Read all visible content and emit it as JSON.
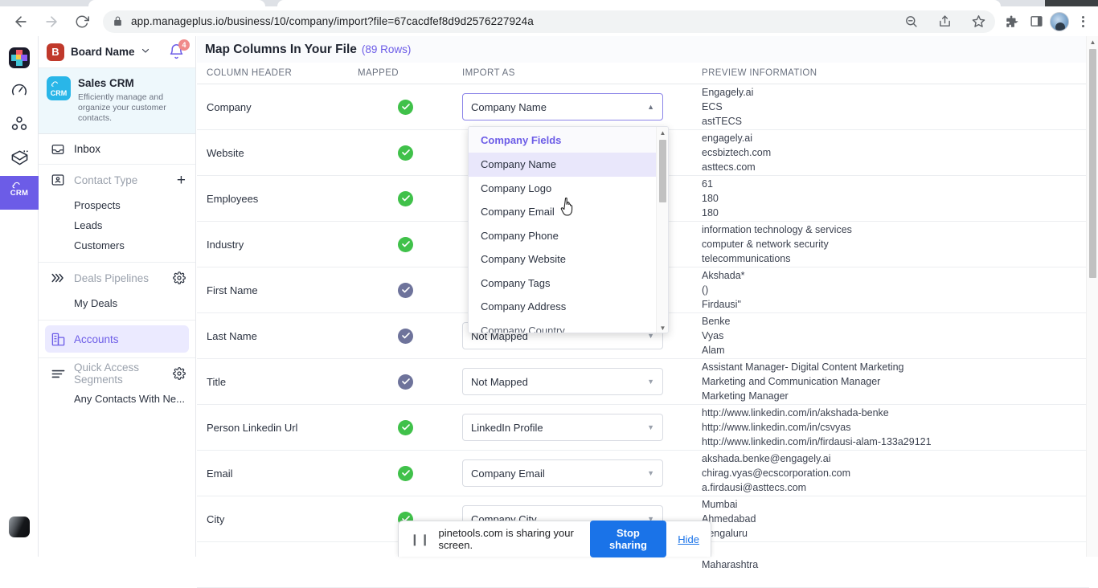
{
  "browser": {
    "url": "app.manageplus.io/business/10/company/import?file=67cacdfef8d9d2576227924a",
    "back_icon": "back-arrow-icon",
    "forward_icon": "forward-arrow-icon",
    "reload_icon": "reload-icon",
    "lock_icon": "lock-icon",
    "zoom_icon": "zoom-out-icon",
    "share_icon": "share-icon",
    "bookmark_icon": "star-icon",
    "extensions_icon": "puzzle-icon",
    "side_panel_icon": "side-panel-icon",
    "profile_icon": "profile-avatar",
    "menu_icon": "three-dot-menu-icon"
  },
  "rail": {
    "items": [
      {
        "name": "app-logo",
        "label": ""
      },
      {
        "name": "dashboard-icon",
        "label": ""
      },
      {
        "name": "teams-icon",
        "label": ""
      },
      {
        "name": "campaigns-icon",
        "label": ""
      },
      {
        "name": "crm-icon",
        "label": "CRM"
      }
    ],
    "bottom_avatar": "user-avatar"
  },
  "sidebar": {
    "board": {
      "badge": "B",
      "name": "Board Name",
      "notifications": "4"
    },
    "product": {
      "badge": "CRM",
      "title": "Sales CRM",
      "description": "Efficiently manage and organize your customer contacts."
    },
    "inbox": "Inbox",
    "contact_type": {
      "label": "Contact Type",
      "items": [
        "Prospects",
        "Leads",
        "Customers"
      ]
    },
    "deals_pipelines": {
      "label": "Deals Pipelines",
      "items": [
        "My Deals"
      ]
    },
    "accounts": "Accounts",
    "quick_access": {
      "label": "Quick Access Segments",
      "items": [
        "Any Contacts With Ne..."
      ]
    }
  },
  "main": {
    "title": "Map Columns In Your File",
    "row_count": "(89 Rows)",
    "columns": [
      "COLUMN HEADER",
      "MAPPED",
      "IMPORT AS",
      "PREVIEW INFORMATION"
    ],
    "rows": [
      {
        "header": "Company",
        "mapped": "green",
        "import_as": "Company Name",
        "open": true,
        "preview": [
          "Engagely.ai",
          "ECS",
          "astTECS"
        ]
      },
      {
        "header": "Website",
        "mapped": "green",
        "import_as": "",
        "preview": [
          "engagely.ai",
          "ecsbiztech.com",
          "asttecs.com"
        ]
      },
      {
        "header": "Employees",
        "mapped": "green",
        "import_as": "",
        "preview": [
          "61",
          "180",
          "180"
        ]
      },
      {
        "header": "Industry",
        "mapped": "green",
        "import_as": "",
        "preview": [
          "information technology & services",
          "computer & network security",
          "telecommunications"
        ]
      },
      {
        "header": "First Name",
        "mapped": "purple",
        "import_as": "",
        "preview": [
          "Akshada*",
          "()",
          "Firdausi\""
        ]
      },
      {
        "header": "Last Name",
        "mapped": "purple",
        "import_as": "Not Mapped",
        "preview": [
          "Benke",
          "Vyas",
          "Alam"
        ]
      },
      {
        "header": "Title",
        "mapped": "purple",
        "import_as": "Not Mapped",
        "preview": [
          "Assistant Manager- Digital Content Marketing",
          "Marketing and Communication Manager",
          "Marketing Manager"
        ]
      },
      {
        "header": "Person Linkedin Url",
        "mapped": "green",
        "import_as": "LinkedIn Profile",
        "preview": [
          "http://www.linkedin.com/in/akshada-benke",
          "http://www.linkedin.com/in/csvyas",
          "http://www.linkedin.com/in/firdausi-alam-133a29121"
        ]
      },
      {
        "header": "Email",
        "mapped": "green",
        "import_as": "Company Email",
        "preview": [
          "akshada.benke@engagely.ai",
          "chirag.vyas@ecscorporation.com",
          "a.firdausi@asttecs.com"
        ]
      },
      {
        "header": "City",
        "mapped": "green",
        "import_as": "Company City",
        "preview": [
          "Mumbai",
          "Ahmedabad",
          "Bengaluru"
        ]
      },
      {
        "header": "",
        "mapped": "",
        "import_as": "",
        "preview": [
          "Maharashtra"
        ]
      }
    ]
  },
  "dropdown": {
    "group_label": "Company Fields",
    "items": [
      "Company Name",
      "Company Logo",
      "Company Email",
      "Company Phone",
      "Company Website",
      "Company Tags",
      "Company Address",
      "Company Country"
    ],
    "selected": "Company Name"
  },
  "share_bar": {
    "message": "pinetools.com is sharing your screen.",
    "stop_label": "Stop sharing",
    "hide_label": "Hide"
  },
  "colors": {
    "accent": "#6c5ce7",
    "success": "#40c14a",
    "muted_check": "#6e739b",
    "chrome_blue": "#1a73e8"
  }
}
